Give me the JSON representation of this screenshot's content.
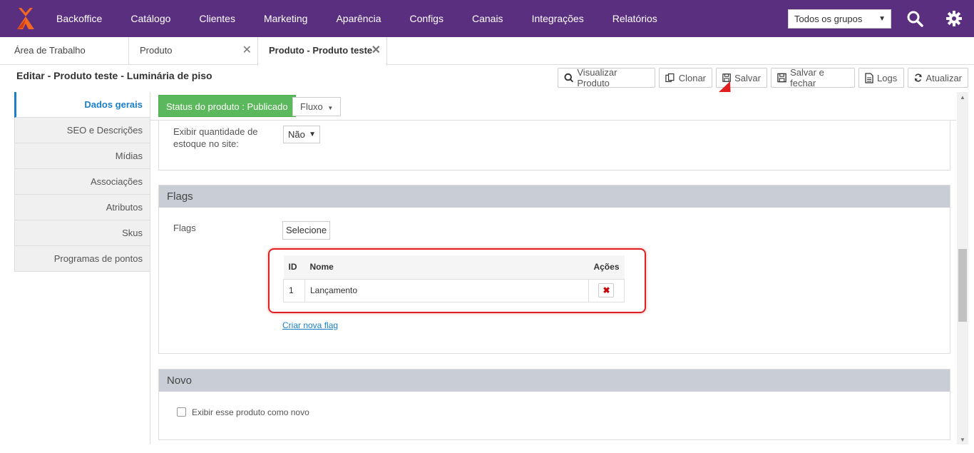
{
  "topnav": {
    "brand": "Backoffice",
    "items": [
      "Catálogo",
      "Clientes",
      "Marketing",
      "Aparência",
      "Configs",
      "Canais",
      "Integrações",
      "Relatórios"
    ],
    "group_select": "Todos os grupos",
    "bg_color": "#5b2f7f"
  },
  "tabs": [
    {
      "label": "Área de Trabalho"
    },
    {
      "label": "Produto"
    },
    {
      "label": "Produto - Produto teste"
    }
  ],
  "page": {
    "title": "Editar - Produto teste - Luminária de piso"
  },
  "toolbar": {
    "view": "Visualizar Produto",
    "clone": "Clonar",
    "save": "Salvar",
    "save_close": "Salvar e fechar",
    "logs": "Logs",
    "refresh": "Atualizar"
  },
  "sidebar": {
    "items": [
      "Dados gerais",
      "SEO e Descrições",
      "Mídias",
      "Associações",
      "Atributos",
      "Skus",
      "Programas de pontos"
    ]
  },
  "status": {
    "badge": "Status do produto : Publicado",
    "flow": "Fluxo"
  },
  "stock": {
    "label": "Exibir quantidade de estoque no site:",
    "value": "Não"
  },
  "flags": {
    "title": "Flags",
    "label": "Flags",
    "select_button": "Selecione",
    "columns": [
      "ID",
      "Nome",
      "Ações"
    ],
    "rows": [
      {
        "id": "1",
        "name": "Lançamento"
      }
    ],
    "create_link": "Criar nova flag"
  },
  "novo": {
    "title": "Novo",
    "checkbox_label": "Exibir esse produto como novo"
  }
}
